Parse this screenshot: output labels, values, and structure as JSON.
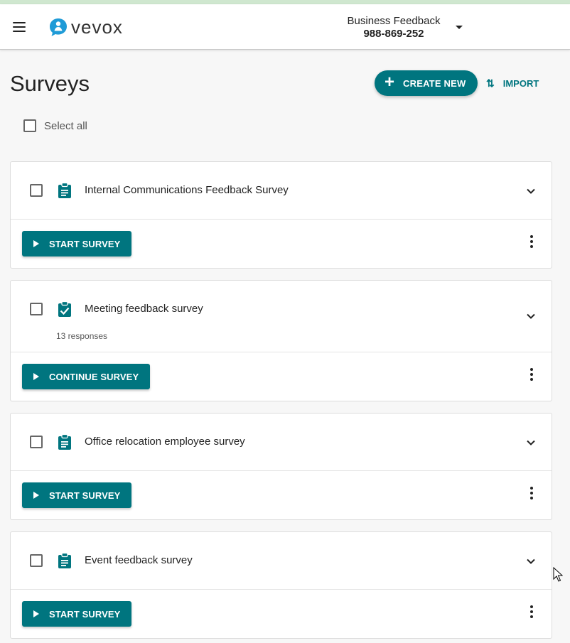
{
  "app": {
    "name": "vevox",
    "logo_icon": "vevox-speech-bubble-logo"
  },
  "header": {
    "menu_icon": "hamburger-menu-icon",
    "account_name": "Business Feedback",
    "account_code": "988-869-252",
    "account_caret_icon": "caret-down-icon"
  },
  "page": {
    "title": "Surveys",
    "create_label": "CREATE NEW",
    "import_label": "IMPORT",
    "select_all_label": "Select all"
  },
  "surveys": [
    {
      "title": "Internal Communications Feedback Survey",
      "status": "not-started",
      "responses": "",
      "action_label": "START SURVEY"
    },
    {
      "title": "Meeting feedback survey",
      "status": "in-progress",
      "responses": "13 responses",
      "action_label": "CONTINUE SURVEY"
    },
    {
      "title": "Office relocation employee survey",
      "status": "not-started",
      "responses": "",
      "action_label": "START SURVEY"
    },
    {
      "title": "Event feedback survey",
      "status": "not-started",
      "responses": "",
      "action_label": "START SURVEY"
    }
  ],
  "colors": {
    "accent": "#00757f",
    "top_bar": "#cfe7cf",
    "background": "#f7f7f7",
    "logo_accent": "#1f9bd7"
  }
}
